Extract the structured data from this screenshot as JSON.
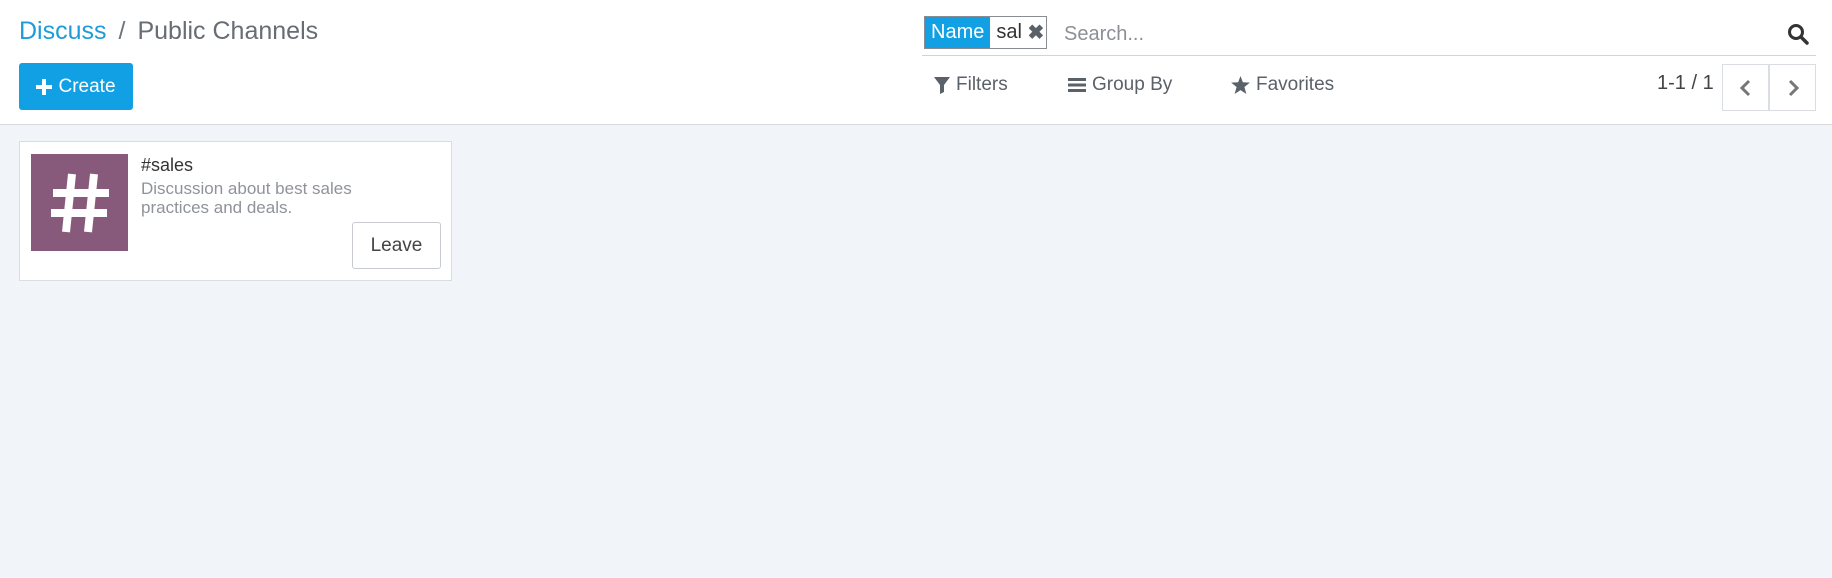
{
  "breadcrumb": {
    "parent": "Discuss",
    "separator": "/",
    "current": "Public Channels"
  },
  "actions": {
    "create_label": "Create"
  },
  "search": {
    "facet_label": "Name",
    "facet_value": "sal",
    "placeholder": "Search..."
  },
  "filters": {
    "filters_label": "Filters",
    "group_by_label": "Group By",
    "favorites_label": "Favorites"
  },
  "pager": {
    "value": "1-1 / 1"
  },
  "channels": [
    {
      "name": "#sales",
      "description": "Discussion about best sales practices and deals.",
      "action_label": "Leave",
      "avatar_color": "#875a7b"
    }
  ],
  "colors": {
    "primary": "#12a0e5",
    "link": "#1c9dd9",
    "background": "#f1f5f9"
  }
}
